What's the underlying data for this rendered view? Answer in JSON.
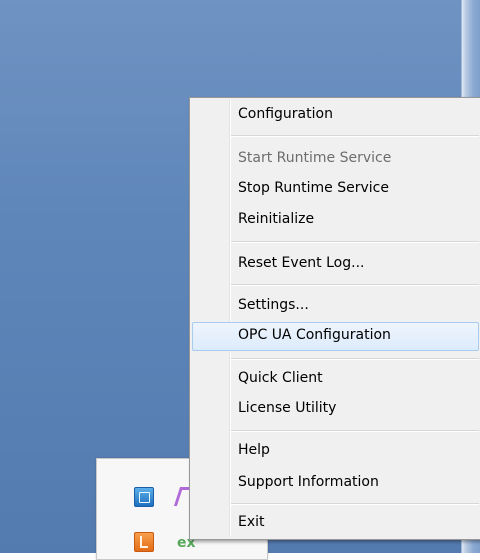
{
  "context_menu": {
    "items": [
      {
        "label": "Configuration",
        "state": "normal"
      },
      {
        "label": "Start Runtime Service",
        "state": "disabled"
      },
      {
        "label": "Stop Runtime Service",
        "state": "normal"
      },
      {
        "label": "Reinitialize",
        "state": "normal"
      },
      {
        "label": "Reset Event Log...",
        "state": "normal"
      },
      {
        "label": "Settings...",
        "state": "normal"
      },
      {
        "label": "OPC UA Configuration",
        "state": "highlighted"
      },
      {
        "label": "Quick Client",
        "state": "normal"
      },
      {
        "label": "License Utility",
        "state": "normal"
      },
      {
        "label": "Help",
        "state": "normal"
      },
      {
        "label": "Support Information",
        "state": "normal"
      },
      {
        "label": "Exit",
        "state": "normal"
      }
    ]
  },
  "tray": {
    "icons": [
      {
        "name": "app-tray-icon-blue"
      },
      {
        "name": "app-tray-icon-purple"
      },
      {
        "name": "app-tray-icon-orange"
      },
      {
        "name": "app-tray-icon-green",
        "text": "ex"
      }
    ]
  },
  "colors": {
    "desktop": "#5f86b9",
    "menu_background": "#f0f0f0",
    "menu_border": "#979797",
    "highlight_fill": "#dcebfc",
    "highlight_border": "#a8cbef",
    "disabled_text": "#6d6d6d"
  }
}
